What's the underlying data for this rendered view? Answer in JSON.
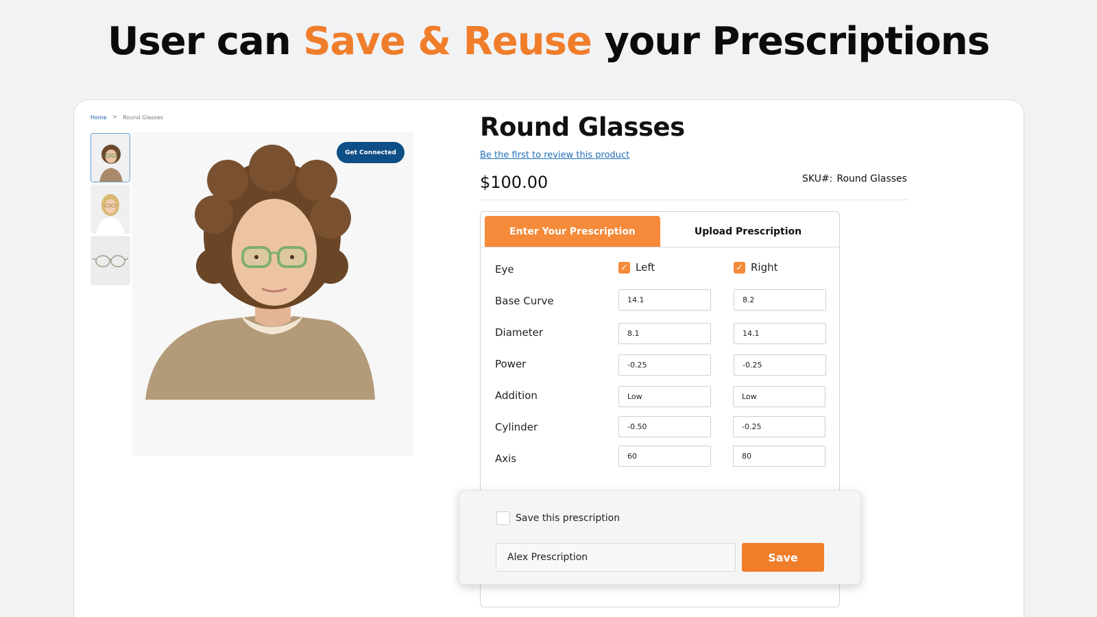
{
  "headline": {
    "part1": "User can ",
    "accent": "Save & Reuse",
    "part2": " your Prescriptions",
    "accent_color": "#f07d2a"
  },
  "breadcrumb": {
    "home": "Home",
    "separator": ">",
    "current": "Round Glasses"
  },
  "gallery": {
    "get_connected_label": "Get Connected",
    "thumbnails": [
      "person-curly-hair-thumbnail",
      "person-blonde-thumbnail",
      "glasses-frame-thumbnail"
    ]
  },
  "product": {
    "title": "Round Glasses",
    "review_link": "Be the first to review this product",
    "price": "$100.00",
    "sku_label": "SKU#:",
    "sku_value": "Round Glasses"
  },
  "prescription": {
    "tabs": {
      "enter": "Enter Your Prescription",
      "upload": "Upload Prescription"
    },
    "eye_label": "Eye",
    "left_label": "Left",
    "right_label": "Right",
    "rows": [
      {
        "label": "Base Curve",
        "left": "14.1",
        "right": "8.2"
      },
      {
        "label": "Diameter",
        "left": "8.1",
        "right": "14.1"
      },
      {
        "label": "Power",
        "left": "-0.25",
        "right": "-0.25"
      },
      {
        "label": "Addition",
        "left": "Low",
        "right": "Low"
      },
      {
        "label": "Cylinder",
        "left": "-0.50",
        "right": "-0.25"
      },
      {
        "label": "Axis",
        "left": "60",
        "right": "80"
      }
    ]
  },
  "save_popup": {
    "checkbox_label": "Save this prescription",
    "name_value": "Alex Prescription",
    "save_label": "Save"
  },
  "colors": {
    "accent": "#f07d2a",
    "tab_active": "#f58a3a",
    "button_blue": "#0d4f86",
    "link": "#1f6db5"
  }
}
